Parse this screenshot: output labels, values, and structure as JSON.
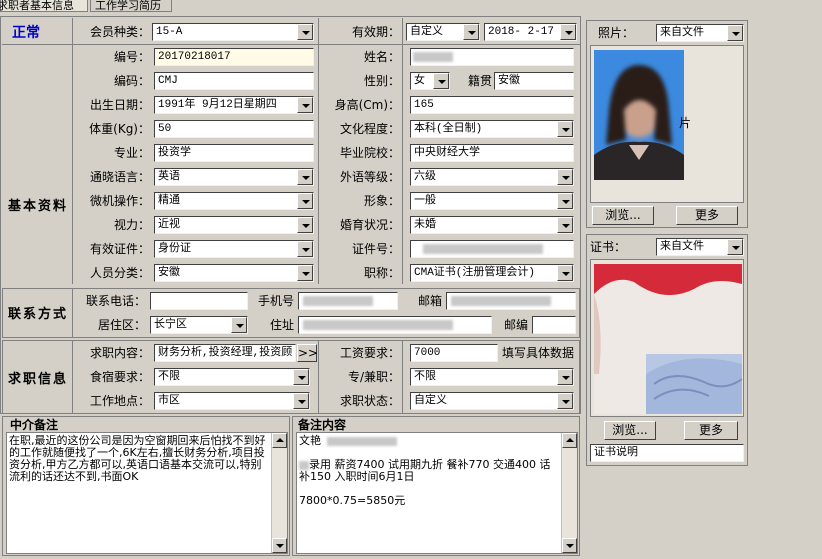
{
  "tabs": [
    "求职者基本信息",
    "工作学习简历"
  ],
  "status": "正常",
  "row_member": {
    "label": "会员种类：",
    "value": "15-A",
    "validity_label": "有效期：",
    "validity_type": "自定义",
    "validity_date": "2018- 2-17"
  },
  "sections": {
    "basic": "基本资料",
    "contact": "联系方式",
    "job": "求职信息"
  },
  "basic": {
    "number_label": "编号：",
    "number": "20170218017",
    "name_label": "姓名：",
    "code_label": "编码：",
    "code": "CMJ",
    "gender_label": "性别：",
    "gender": "女",
    "origin_label": "籍贯",
    "origin": "安徽",
    "birth_label": "出生日期：",
    "birth": "1991年 9月12日星期四",
    "height_label": "身高(Cm)：",
    "height": "165",
    "weight_label": "体重(Kg)：",
    "weight": "50",
    "edu_label": "文化程度：",
    "edu": "本科(全日制)",
    "major_label": "专业：",
    "major": "投资学",
    "school_label": "毕业院校：",
    "school": "中央财经大学",
    "lang_label": "通晓语言：",
    "lang": "英语",
    "lang_level_label": "外语等级：",
    "lang_level": "六级",
    "computer_label": "微机操作：",
    "computer": "精通",
    "image_label": "形象：",
    "image": "一般",
    "vision_label": "视力：",
    "vision": "近视",
    "marriage_label": "婚育状况：",
    "marriage": "未婚",
    "id_type_label": "有效证件：",
    "id_type": "身份证",
    "id_no_label": "证件号：",
    "category_label": "人员分类：",
    "category": "安徽",
    "title_label": "职称：",
    "title": "CMA证书(注册管理会计)"
  },
  "contact": {
    "phone_label": "联系电话：",
    "phone": "",
    "mobile_label": "手机号",
    "mailbox_label": "邮箱",
    "district_label": "居住区：",
    "district": "长宁区",
    "address_label": "住址",
    "zip_label": "邮编"
  },
  "job": {
    "content_label": "求职内容：",
    "content": "财务分析,投资经理,投资顾",
    "more_btn": ">>",
    "salary_label": "工资要求：",
    "salary": "7000",
    "salary_hint": "填写具体数据",
    "food_label": "食宿要求：",
    "food": "不限",
    "parttime_label": "专/兼职：",
    "parttime": "不限",
    "location_label": "工作地点：",
    "location": "市区",
    "status_label": "求职状态：",
    "status": "自定义"
  },
  "agency_note": {
    "title": "中介备注",
    "text": "在职,最近的这份公司是因为空窗期回来后怕找不到好的工作就随便找了一个,6K左右,擅长财务分析,项目投资分析,甲方乙方都可以,英语口语基本交流可以,特别流利的话还达不到,书面OK"
  },
  "remark": {
    "title": "备注内容",
    "line1": "文艳",
    "line2": "录用  薪资7400 试用期九折  餐补770 交通400 话补150 入职时间6月1日",
    "line3": "7800*0.75=5850元"
  },
  "photo": {
    "label": "照片：",
    "source": "来自文件",
    "browse": "浏览...",
    "more": "更多",
    "side_text": "片"
  },
  "cert": {
    "label": "证书：",
    "source": "来自文件",
    "browse": "浏览...",
    "more": "更多",
    "desc": "证书说明"
  }
}
